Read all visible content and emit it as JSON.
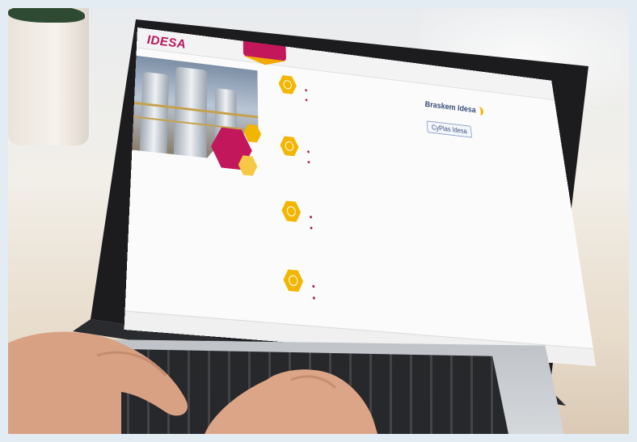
{
  "site": {
    "logo": "IDESA",
    "nav_tab": "",
    "subnav": "",
    "left_title": "",
    "left_text": "",
    "left_sub": "",
    "sections": [
      {
        "heading": "",
        "lines": [
          "",
          ""
        ]
      },
      {
        "heading": "",
        "lines": [
          "",
          ""
        ]
      },
      {
        "heading": "",
        "lines": [
          "",
          ""
        ]
      },
      {
        "heading": "",
        "lines": [
          "",
          ""
        ]
      }
    ],
    "right_heading": "",
    "right_text1": "",
    "brand1": "Braskem Idesa",
    "right_text2": "",
    "brand2": "CyPlas Idesa",
    "right_text3": "",
    "footer": ""
  },
  "colors": {
    "brand": "#b5175c",
    "accent": "#f2b600"
  }
}
